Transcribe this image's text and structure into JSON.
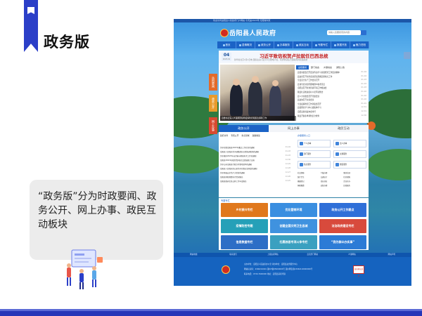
{
  "slide": {
    "title": "政务版",
    "description": "“政务版”分为时政要闻、政务公开、网上办事、政民互动板块"
  },
  "site": {
    "topbar_text": "欢迎访问岳阳县人民政府门户网站  今天是2023年  无障碍浏览",
    "title": "岳阳县人民政府",
    "search_placeholder": "请输入您要搜索的内容",
    "nav": [
      "首页",
      "县情概况",
      "政务公开",
      "办事服务",
      "政民互动",
      "专题专栏",
      "数据开放",
      "魅力岳阳"
    ],
    "headline": {
      "day": "04",
      "month": "2023-01",
      "title": "习近平致信祝贺卢拉就任巴西总统",
      "sub": "新华社北京1月1日电 国家主席习近平1日致电卢拉，祝贺他就任巴西联邦共和国总统"
    },
    "photo_caption": "县委书记深入乡镇调研指导疫情防控和民生保障工作",
    "news_tabs": [
      "岳阳要闻",
      "部门动态",
      "乡镇动态",
      "通知公告"
    ],
    "news_items": [
      {
        "t": "县委常委会召开会议传达学习省委经济工作会议精神",
        "d": "01-04"
      },
      {
        "t": "县政府召开常务会议研究部署近期重点工作",
        "d": "01-04"
      },
      {
        "t": "全县安全生产工作会议召开",
        "d": "01-03"
      },
      {
        "t": "县领导走访慰问困难群众和老党员",
        "d": "01-03"
      },
      {
        "t": "岳阳县召开优化营商环境工作推进会",
        "d": "01-03"
      },
      {
        "t": "我县扎实推进农村人居环境整治",
        "d": "01-02"
      },
      {
        "t": "县人大常委会召开党组会议",
        "d": "01-02"
      },
      {
        "t": "县政协召开主席会议",
        "d": "01-02"
      },
      {
        "t": "全县疫情防控工作调度会召开",
        "d": "01-01"
      },
      {
        "t": "县委理论学习中心组集体学习",
        "d": "12-31"
      },
      {
        "t": "岳阳县新闻发布会举行",
        "d": "12-31"
      },
      {
        "t": "我县开展冬季消防安全检查",
        "d": "12-30"
      }
    ],
    "side_tabs": [
      "岳阳要闻",
      "政务公开",
      "网上办事"
    ],
    "sections": [
      "政务公开",
      "网上办事",
      "政民互动"
    ],
    "gov_sub": [
      "政府文件",
      "专项公开",
      "重点领域",
      "政策解读"
    ],
    "gov_items": [
      {
        "t": "关于印发岳阳县2023年重点工作任务的通知",
        "d": "01-04"
      },
      {
        "t": "岳阳县人民政府关于调整部分议事协调机构的通知",
        "d": "01-03"
      },
      {
        "t": "关于做好2023年元旦春节期间有关工作的通知",
        "d": "01-03"
      },
      {
        "t": "岳阳县2022年国民经济和社会发展统计公报",
        "d": "12-30"
      },
      {
        "t": "关于公布岳阳县行政许可事项清单的通知",
        "d": "12-29"
      },
      {
        "t": "岳阳县人民政府办公室关于印发应急预案的通知",
        "d": "12-28"
      },
      {
        "t": "关于开展安全生产大检查的通知",
        "d": "12-27"
      },
      {
        "t": "岳阳县财政预算执行情况报告",
        "d": "12-26"
      },
      {
        "t": "岳阳县政府信息公开工作年度报告",
        "d": "12-25"
      }
    ],
    "service_title": "办事服务入口",
    "services": [
      "个人办事",
      "法人办事",
      "部门服务",
      "主题服务",
      "热点服务",
      "便民服务"
    ],
    "services2": [
      "社会保障",
      "户籍办理",
      "教育培训",
      "医疗卫生",
      "交通出行",
      "住房保障",
      "婚姻登记",
      "就业创业",
      "企业开办",
      "纳税缴费",
      "证照办理",
      "民政服务"
    ],
    "special_title": "专题专栏",
    "banners": [
      {
        "text": "乡村振兴专栏",
        "color": "#e0781c"
      },
      {
        "text": "优化营商环境",
        "color": "#3a8ee0"
      },
      {
        "text": "政务公开工作要点",
        "color": "#2f6fd8"
      },
      {
        "text": "疫情防控专题",
        "color": "#25a0b8"
      },
      {
        "text": "创建全国文明卫生县城",
        "color": "#3f92df"
      },
      {
        "text": "法治政府建设专栏",
        "color": "#d84a3c"
      },
      {
        "text": "信息数据专栏",
        "color": "#2d6ec6"
      },
      {
        "text": "扫黑除恶专项斗争专栏",
        "color": "#3aa0c0"
      },
      {
        "text": "“我为群众办实事”",
        "color": "#2c7bd6"
      }
    ],
    "footer_links": [
      "网站地图",
      "联系我们",
      "上级政府网站",
      "县直部门网站",
      "乡镇网站",
      "网站声明"
    ],
    "footer_lines": [
      "主办单位：岳阳县人民政府办公室  承办单位：岳阳县政务服务中心",
      "网站标识码：4306210001  湘ICP备05000000号  湘公网安备43062102000000号",
      "联系电话：0730-7600000  地址：岳阳县荣家湾镇"
    ],
    "footer_badge": "政府网站找错"
  }
}
